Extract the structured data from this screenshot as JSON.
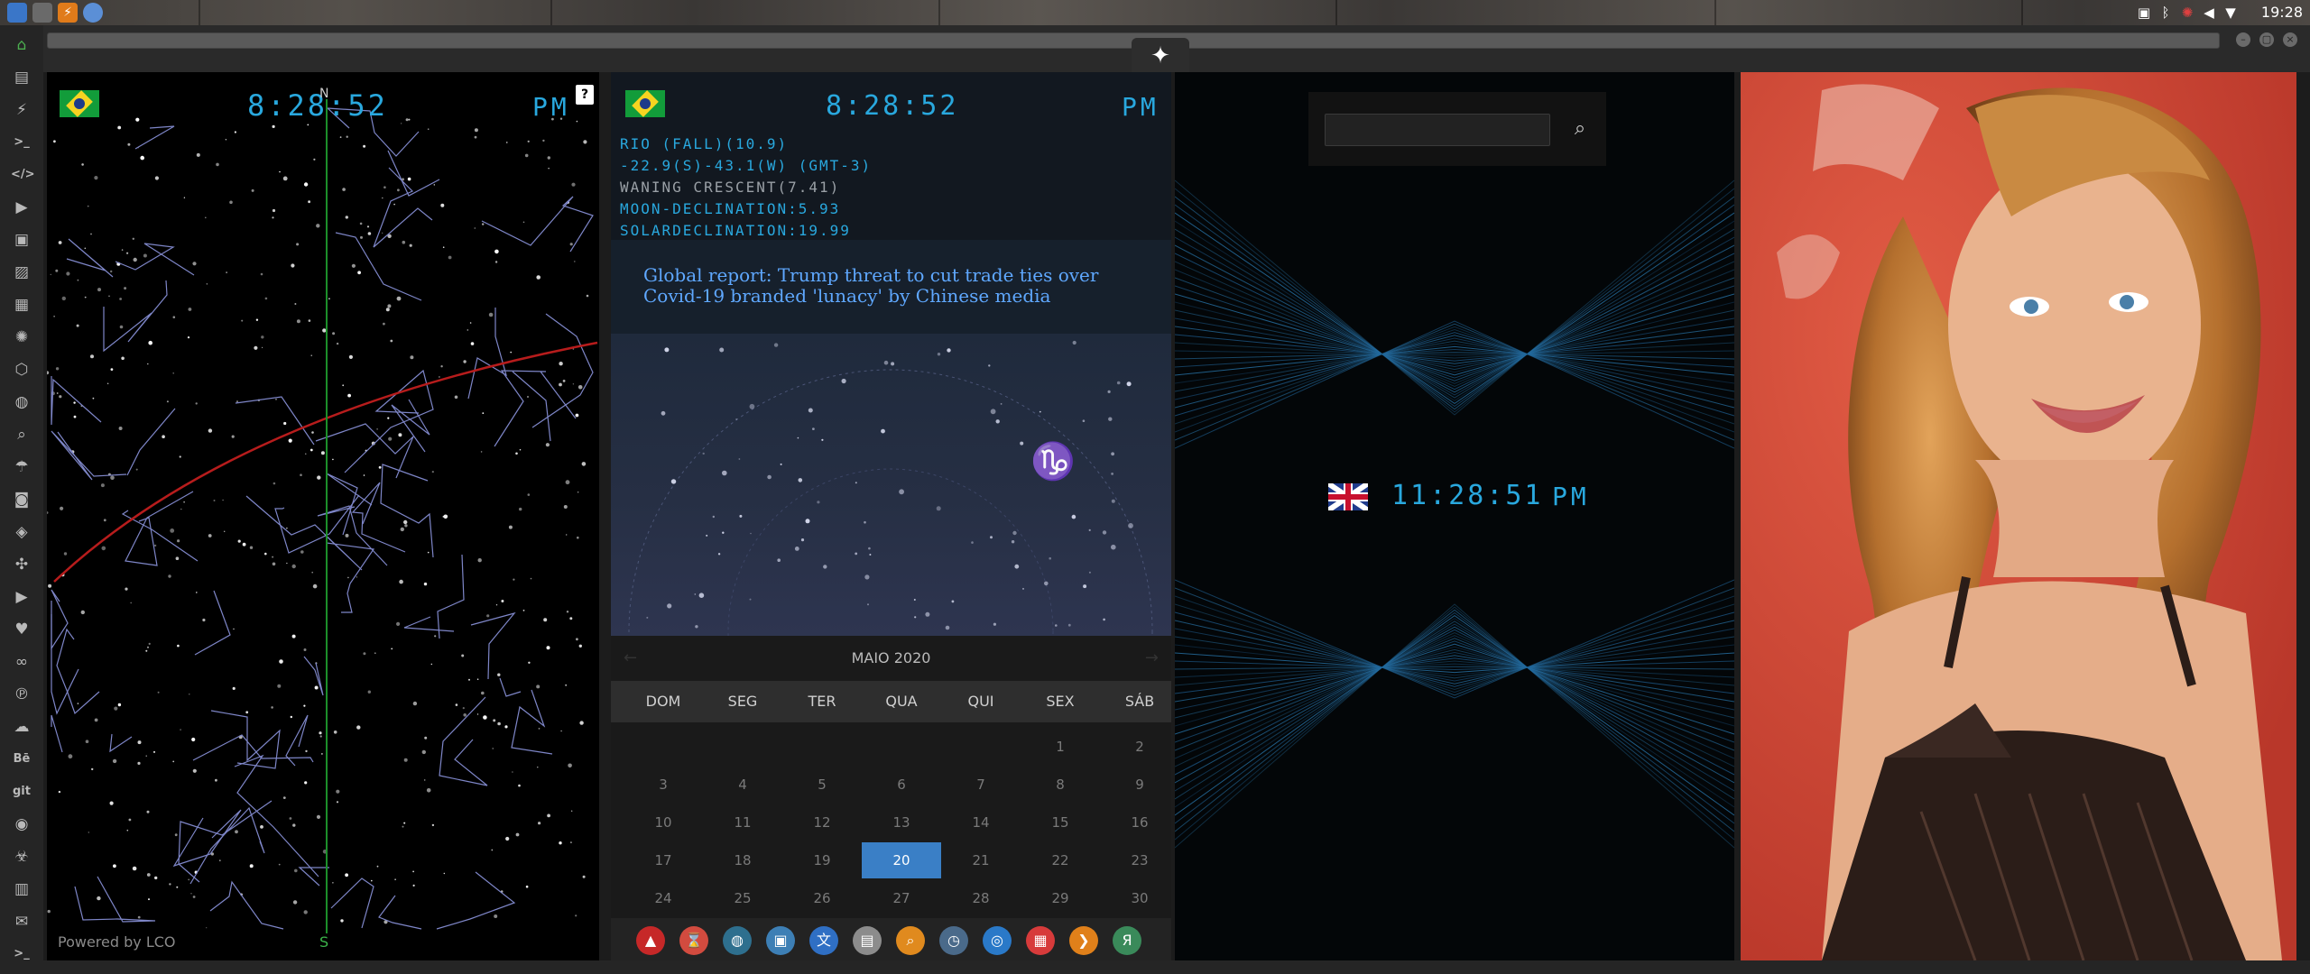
{
  "os_panel": {
    "clock": "19:28",
    "app_icons": [
      "files-icon",
      "window-icon",
      "bolt-icon",
      "chrome-icon"
    ],
    "tray_icons": [
      "image-icon",
      "bluetooth-icon",
      "gear-icon",
      "volume-icon",
      "wifi-icon"
    ]
  },
  "launcher": {
    "items": [
      {
        "name": "home",
        "glyph": "⌂",
        "active": true
      },
      {
        "name": "document",
        "glyph": "▤"
      },
      {
        "name": "bolt",
        "glyph": "⚡"
      },
      {
        "name": "terminal",
        "glyph": ">_"
      },
      {
        "name": "code",
        "glyph": "</>"
      },
      {
        "name": "play",
        "glyph": "▶"
      },
      {
        "name": "clipboard",
        "glyph": "▣"
      },
      {
        "name": "image",
        "glyph": "▨"
      },
      {
        "name": "news",
        "glyph": "▦"
      },
      {
        "name": "settings",
        "glyph": "✺"
      },
      {
        "name": "hexagon",
        "glyph": "⬡"
      },
      {
        "name": "globe",
        "glyph": "◍"
      },
      {
        "name": "search",
        "glyph": "⌕"
      },
      {
        "name": "umbrella",
        "glyph": "☂"
      },
      {
        "name": "contacts",
        "glyph": "◙"
      },
      {
        "name": "tag",
        "glyph": "◈"
      },
      {
        "name": "puzzle",
        "glyph": "✣"
      },
      {
        "name": "youtube",
        "glyph": "▶"
      },
      {
        "name": "heart",
        "glyph": "♥"
      },
      {
        "name": "infinity",
        "glyph": "∞"
      },
      {
        "name": "pinterest",
        "glyph": "℗"
      },
      {
        "name": "cloud",
        "glyph": "☁"
      },
      {
        "name": "behance",
        "glyph": "Bē"
      },
      {
        "name": "git",
        "glyph": "git"
      },
      {
        "name": "github",
        "glyph": "◉"
      },
      {
        "name": "biohazard",
        "glyph": "☣"
      },
      {
        "name": "map",
        "glyph": "▥"
      },
      {
        "name": "mail",
        "glyph": "✉"
      },
      {
        "name": "terminal-2",
        "glyph": ">_"
      }
    ]
  },
  "browser": {
    "emblem": "rebel-alliance-icon",
    "window_buttons": [
      "–",
      "▢",
      "×"
    ]
  },
  "sky_widget": {
    "time": "8:28:52",
    "ampm": "PM",
    "help_label": "?",
    "north_label": "N",
    "south_label": "S",
    "powered_by": "Powered by LCO"
  },
  "astro_widget": {
    "time": "8:28:52",
    "ampm": "PM",
    "lines": [
      "RIO (FALL)(10.9)",
      "-22.9(S)-43.1(W) (GMT-3)",
      "WANING CRESCENT(7.41)",
      "MOON-DECLINATION:5.93",
      "SOLARDECLINATION:19.99"
    ],
    "news_headline": "Global report: Trump threat to cut trade ties over Covid-19 branded 'lunacy' by Chinese media"
  },
  "calendar": {
    "month_label": "MAIO 2020",
    "prev_label": "←",
    "next_label": "→",
    "weekdays": [
      "DOM",
      "SEG",
      "TER",
      "QUA",
      "QUI",
      "SEX",
      "SÁB"
    ],
    "weeks": [
      [
        "",
        "",
        "",
        "",
        "",
        "1",
        "2"
      ],
      [
        "3",
        "4",
        "5",
        "6",
        "7",
        "8",
        "9"
      ],
      [
        "10",
        "11",
        "12",
        "13",
        "14",
        "15",
        "16"
      ],
      [
        "17",
        "18",
        "19",
        "20",
        "21",
        "22",
        "23"
      ],
      [
        "24",
        "25",
        "26",
        "27",
        "28",
        "29",
        "30"
      ]
    ],
    "today": "20"
  },
  "dock": {
    "items": [
      {
        "name": "arrow-app-icon",
        "glyph": "▲",
        "color": "#c62828"
      },
      {
        "name": "hourglass-icon",
        "glyph": "⌛",
        "color": "#d24b3f"
      },
      {
        "name": "planet-icon",
        "glyph": "◍",
        "color": "#2e6f8e"
      },
      {
        "name": "photo-app-icon",
        "glyph": "▣",
        "color": "#3d7fb5"
      },
      {
        "name": "translate-icon",
        "glyph": "文",
        "color": "#2f6fc4"
      },
      {
        "name": "news-app-icon",
        "glyph": "▤",
        "color": "#8c8c8c"
      },
      {
        "name": "magnifier-app-icon",
        "glyph": "⌕",
        "color": "#e08a1e"
      },
      {
        "name": "clock-app-icon",
        "glyph": "◷",
        "color": "#4a6a8a"
      },
      {
        "name": "globe-app-icon",
        "glyph": "◎",
        "color": "#2a79c8"
      },
      {
        "name": "calendar-app-icon",
        "glyph": "▦",
        "color": "#d73b3b"
      },
      {
        "name": "play-app-icon",
        "glyph": "❯",
        "color": "#e0801a"
      },
      {
        "name": "yandex-icon",
        "glyph": "Я",
        "color": "#3a8a5a"
      }
    ]
  },
  "geo_widget": {
    "search_placeholder": "",
    "uk_time": "11:28:51",
    "uk_ampm": "PM"
  },
  "colors": {
    "digital": "#29a8de",
    "ecliptic": "#b71c1c",
    "meridian": "#1c8f2a",
    "today": "#3a7fc6",
    "news_link": "#5fa8ff"
  }
}
